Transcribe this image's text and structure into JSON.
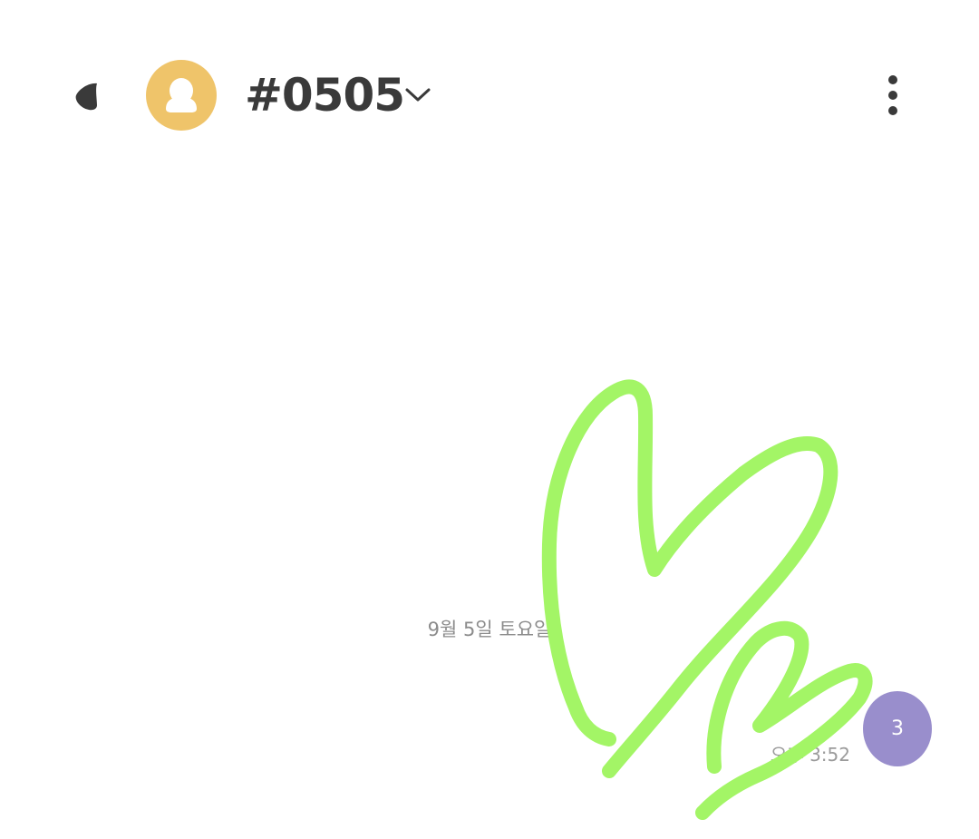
{
  "header": {
    "back_icon": "back-chevron-icon",
    "avatar_icon": "default-person-icon",
    "title": "#0505",
    "dropdown_icon": "chevron-down-icon",
    "more_icon": "vertical-dots-icon"
  },
  "conversation": {
    "date_divider": "9월 5일 토요일",
    "message": {
      "time": "오후 3:52",
      "unread_count": "3"
    }
  },
  "colors": {
    "avatar_bg": "#efc46a",
    "badge_bg": "#998ecc",
    "doodle_stroke": "#a3f566",
    "text_primary": "#3a3a3a",
    "text_secondary": "#8c8c8c"
  },
  "overlay": {
    "type": "hand-drawn hearts doodle",
    "color": "#a3f566"
  }
}
